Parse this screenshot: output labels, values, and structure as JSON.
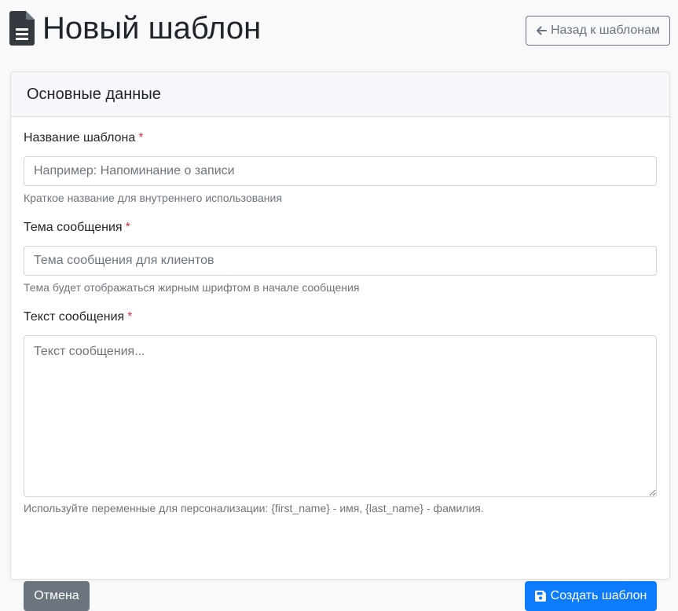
{
  "header": {
    "title": "Новый шаблон",
    "title_icon": "file-text-icon",
    "back_button": {
      "label": "Назад к шаблонам",
      "icon": "arrow-left-icon"
    }
  },
  "card": {
    "title": "Основные данные",
    "fields": {
      "name": {
        "label": "Название шаблона",
        "required_mark": "*",
        "value": "",
        "placeholder": "Например: Напоминание о записи",
        "help": "Краткое название для внутреннего использования"
      },
      "subject": {
        "label": "Тема сообщения",
        "required_mark": "*",
        "value": "",
        "placeholder": "Тема сообщения для клиентов",
        "help": "Тема будет отображаться жирным шрифтом в начале сообщения"
      },
      "body": {
        "label": "Текст сообщения",
        "required_mark": "*",
        "value": "",
        "placeholder": "Текст сообщения...",
        "help": "Используйте переменные для персонализации: {first_name} - имя, {last_name} - фамилия."
      }
    },
    "actions": {
      "cancel_label": "Отмена",
      "submit_label": "Создать шаблон",
      "submit_icon": "save-icon"
    }
  },
  "colors": {
    "primary": "#0d7bfd",
    "secondary": "#6c757d",
    "danger": "#dc3545",
    "background": "#f8f9fa"
  }
}
